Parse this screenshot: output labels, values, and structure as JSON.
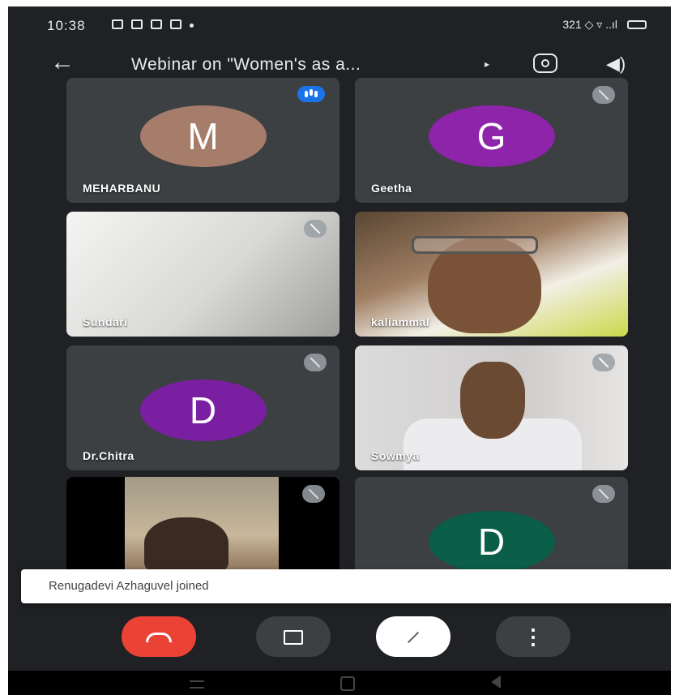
{
  "status_bar": {
    "time": "10:38",
    "right_text": "321 ◇ ▿ ..ıl"
  },
  "app_bar": {
    "title": "Webinar on \"Women's as a...",
    "back_icon": "←",
    "caret_icon": "▸",
    "speaker_icon": "◀)"
  },
  "colors": {
    "background": "#202124",
    "tile": "#3c4043",
    "end_call": "#ea4335",
    "speaking": "#1a73e8"
  },
  "participants": [
    {
      "name": "MEHARBANU",
      "initial": "M",
      "avatar_color": "#a67c6a",
      "status": "speaking"
    },
    {
      "name": "Geetha",
      "initial": "G",
      "avatar_color": "#8e24aa",
      "status": "muted"
    },
    {
      "name": "Sundari",
      "status": "muted",
      "video": true
    },
    {
      "name": "kaliammal",
      "video": true
    },
    {
      "name": "Dr.Chitra",
      "initial": "D",
      "avatar_color": "#7b1fa2",
      "status": "muted"
    },
    {
      "name": "Sowmya",
      "status": "muted",
      "video": true
    },
    {
      "name": "",
      "status": "muted",
      "video": true
    },
    {
      "name": "",
      "initial": "D",
      "avatar_color": "#0b5e47",
      "status": "muted"
    }
  ],
  "toast": {
    "text": "Renugadevi Azhaguvel joined"
  },
  "controls": {
    "more_label": "⋮"
  }
}
